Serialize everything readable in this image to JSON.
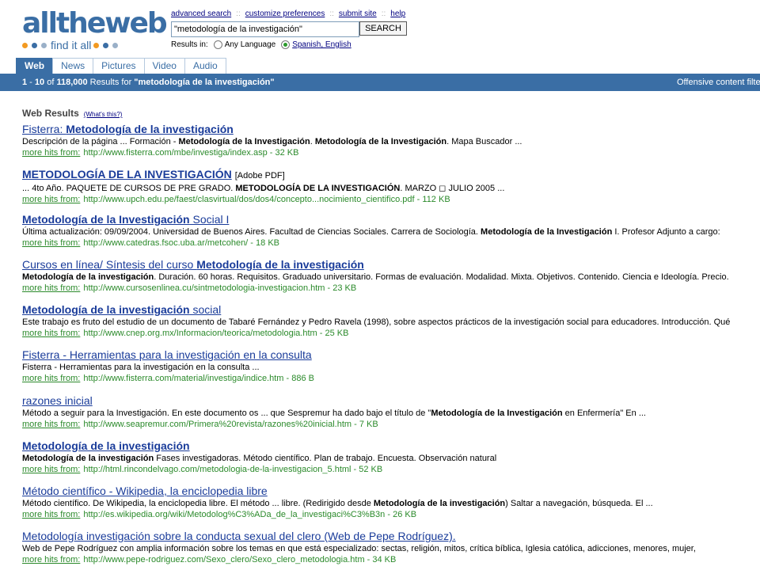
{
  "logo": {
    "word": "alltheweb",
    "tagline": "find it all"
  },
  "toplinks": [
    "advanced search",
    "customize preferences",
    "submit site",
    "help"
  ],
  "search": {
    "value": "\"metodología de la investigación\"",
    "button": "SEARCH"
  },
  "results_in": {
    "label": "Results in:",
    "options": [
      "Any Language",
      "Spanish, English"
    ],
    "selected": 1
  },
  "tabs": [
    "Web",
    "News",
    "Pictures",
    "Video",
    "Audio"
  ],
  "active_tab": "Web",
  "resultbar": {
    "range_start": "1",
    "range_sep": " - ",
    "range_end": "10",
    "of_label": " of ",
    "total": "118,000",
    "results_for": " Results for ",
    "query": "\"metodología de la investigación\"",
    "filter": "Offensive content filter"
  },
  "web_results": {
    "heading": "Web Results",
    "whats_this": "(What's this?)"
  },
  "more_hits_label": "more hits from:",
  "results": [
    {
      "title": [
        {
          "t": "Fisterra: ",
          "b": false
        },
        {
          "t": "Metodología de la investigación",
          "b": true
        }
      ],
      "suffix": "",
      "desc": [
        {
          "t": "Descripción de la página ... Formación - ",
          "b": false
        },
        {
          "t": "Metodología de la Investigación",
          "b": true
        },
        {
          "t": ". ",
          "b": false
        },
        {
          "t": "Metodología de la Investigación",
          "b": true
        },
        {
          "t": ". Mapa Buscador ...",
          "b": false
        }
      ],
      "url": "http://www.fisterra.com/mbe/investiga/index.asp",
      "size": "32 KB"
    },
    {
      "title": [
        {
          "t": "METODOLOGÍA DE LA INVESTIGACIÓN",
          "b": true
        }
      ],
      "suffix": "[Adobe PDF]",
      "desc": [
        {
          "t": "... 4to Año. PAQUETE DE CURSOS DE PRE GRADO. ",
          "b": false
        },
        {
          "t": "METODOLOGÍA DE LA INVESTIGACIÓN",
          "b": true
        },
        {
          "t": ". MARZO ◻ JULIO 2005 ...",
          "b": false
        }
      ],
      "url": "http://www.upch.edu.pe/faest/clasvirtual/dos/dos4/concepto...nocimiento_cientifico.pdf",
      "size": "112 KB"
    },
    {
      "title": [
        {
          "t": "Metodología de la Investigación",
          "b": true
        },
        {
          "t": " Social I",
          "b": false
        }
      ],
      "suffix": "",
      "desc": [
        {
          "t": "Última actualización: 09/09/2004. Universidad de Buenos Aires. Facultad de Ciencias Sociales. Carrera de Sociología. ",
          "b": false
        },
        {
          "t": "Metodología de la Investigación",
          "b": true
        },
        {
          "t": " I. Profesor Adjunto a cargo:",
          "b": false
        }
      ],
      "url": "http://www.catedras.fsoc.uba.ar/metcohen/",
      "size": "18 KB"
    },
    {
      "title": [
        {
          "t": "Cursos en línea/ Síntesis del curso ",
          "b": false
        },
        {
          "t": "Metodología de la investigación",
          "b": true
        }
      ],
      "suffix": "",
      "desc": [
        {
          "t": "Metodología de la investigación",
          "b": true
        },
        {
          "t": ". Duración. 60 horas. Requisitos. Graduado universitario. Formas de evaluación. Modalidad. Mixta. Objetivos. Contenido. Ciencia e Ideología. Precio.",
          "b": false
        }
      ],
      "url": "http://www.cursosenlinea.cu/sintmetodologia-investigacion.htm",
      "size": "23 KB"
    },
    {
      "title": [
        {
          "t": "Metodología de la investigación",
          "b": true
        },
        {
          "t": " social",
          "b": false
        }
      ],
      "suffix": "",
      "desc": [
        {
          "t": "Este trabajo es fruto del estudio de un documento de Tabaré Fernández y Pedro Ravela (1998), sobre aspectos prácticos de la investigación social para educadores. Introducción. Qué",
          "b": false
        }
      ],
      "url": "http://www.cnep.org.mx/Informacion/teorica/metodologia.htm",
      "size": "25 KB"
    },
    {
      "title": [
        {
          "t": "Fisterra - Herramientas para la investigación en la consulta",
          "b": false
        }
      ],
      "suffix": "",
      "desc": [
        {
          "t": "Fisterra - Herramientas para la investigación en la consulta ...",
          "b": false
        }
      ],
      "url": "http://www.fisterra.com/material/investiga/indice.htm",
      "size": "886 B"
    },
    {
      "title": [
        {
          "t": "razones inicial",
          "b": false
        }
      ],
      "suffix": "",
      "desc": [
        {
          "t": "Método a seguir para la Investigación. En este documento os ... que Sespremur ha dado bajo el título de \"",
          "b": false
        },
        {
          "t": "Metodología de la Investigación",
          "b": true
        },
        {
          "t": " en Enfermería\" En ...",
          "b": false
        }
      ],
      "url": "http://www.seapremur.com/Primera%20revista/razones%20inicial.htm",
      "size": "7 KB"
    },
    {
      "title": [
        {
          "t": "Metodología de la investigación",
          "b": true
        }
      ],
      "suffix": "",
      "desc": [
        {
          "t": "Metodología de la investigación",
          "b": true
        },
        {
          "t": " Fases investigadoras. Método científico. Plan de trabajo. Encuesta. Observación natural",
          "b": false
        }
      ],
      "url": "http://html.rincondelvago.com/metodologia-de-la-investigacion_5.html",
      "size": "52 KB"
    },
    {
      "title": [
        {
          "t": "Método científico - Wikipedia, la enciclopedia libre",
          "b": false
        }
      ],
      "suffix": "",
      "desc": [
        {
          "t": "Método científico. De Wikipedia, la enciclopedia libre. El método ... libre. (Redirigido desde ",
          "b": false
        },
        {
          "t": "Metodología de la investigación",
          "b": true
        },
        {
          "t": ") Saltar a navegación, búsqueda. El ...",
          "b": false
        }
      ],
      "url": "http://es.wikipedia.org/wiki/Metodolog%C3%ADa_de_la_investigaci%C3%B3n",
      "size": "26 KB"
    },
    {
      "title": [
        {
          "t": "Metodología investigación sobre la conducta sexual del clero (Web de Pepe Rodríguez).",
          "b": false
        }
      ],
      "suffix": "",
      "desc": [
        {
          "t": "Web de Pepe Rodríguez con amplia información sobre los temas en que está especializado: sectas, religión, mitos, crítica bíblica, Iglesia católica, adicciones, menores, mujer,",
          "b": false
        }
      ],
      "url": "http://www.pepe-rodriguez.com/Sexo_clero/Sexo_clero_metodologia.htm",
      "size": "34 KB"
    }
  ],
  "colors": {
    "brand_blue": "#3a6ea5",
    "link": "#1a3c9a",
    "url_green": "#2b8a2b",
    "accent_orange": "#f39a21"
  }
}
